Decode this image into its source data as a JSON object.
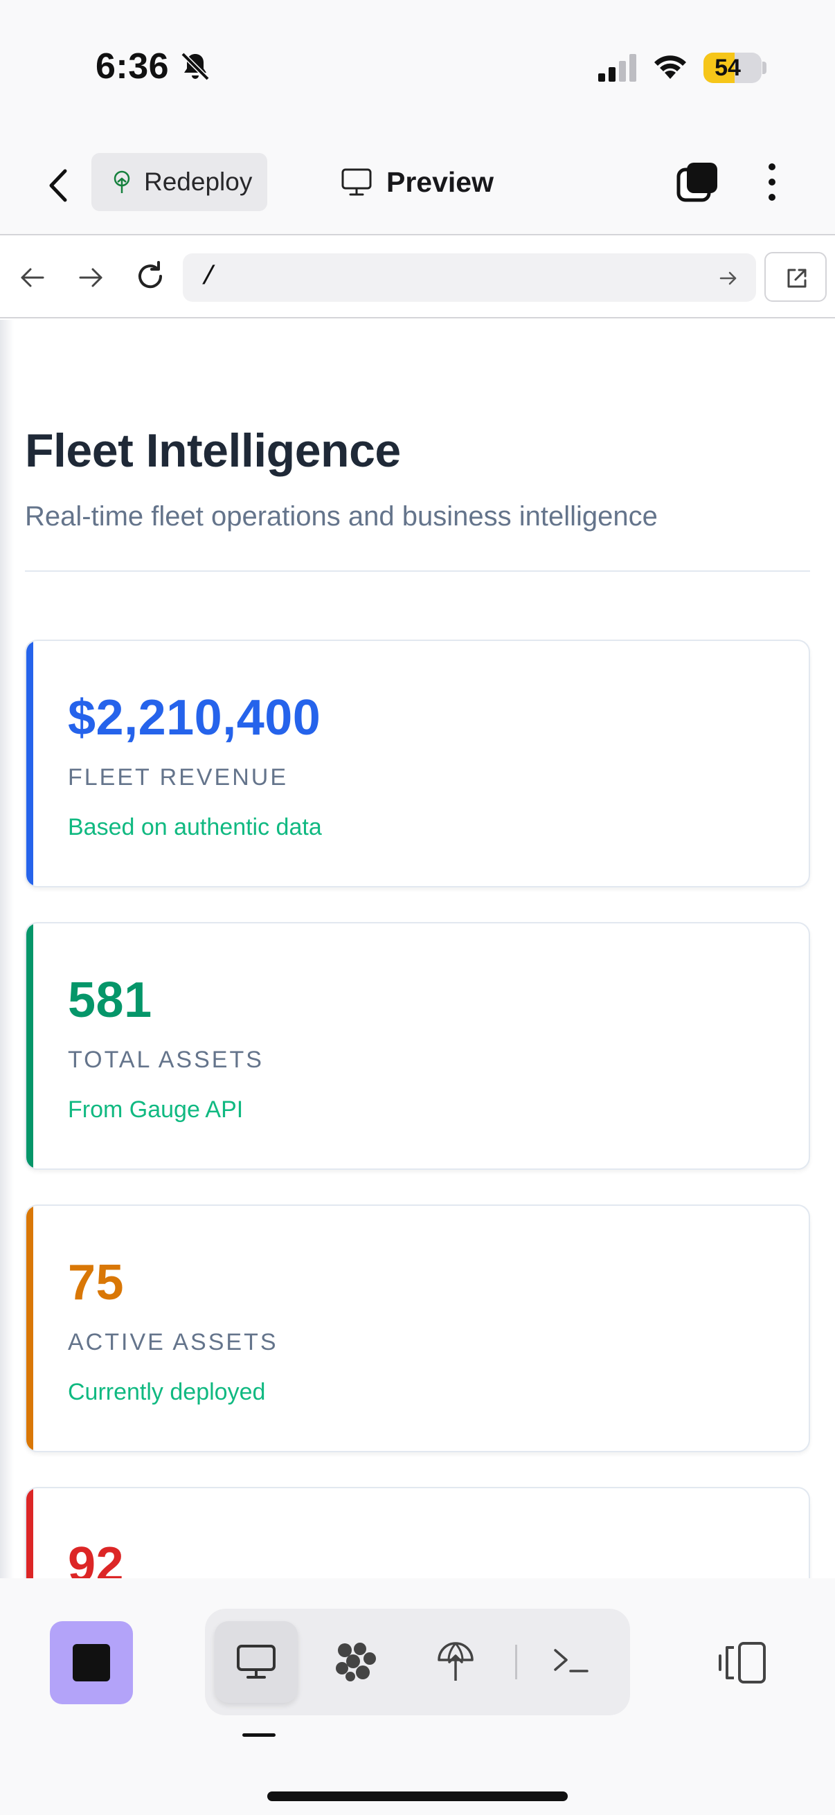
{
  "status_bar": {
    "time": "6:36",
    "battery_level": "54",
    "battery_fraction": 0.54,
    "battery_color": "#f6c619",
    "icons": [
      "bell-slash-icon",
      "cellular-signal-icon",
      "wifi-icon",
      "battery-icon"
    ]
  },
  "header": {
    "back_icon": "chevron-left-icon",
    "redeploy_label": "Redeploy",
    "redeploy_icon": "deploy-tree-icon",
    "preview_label": "Preview",
    "preview_icon": "monitor-icon",
    "tabs_icon": "tabs-stack-icon",
    "more_icon": "vertical-dots-icon"
  },
  "browser": {
    "url": "/",
    "icons": [
      "arrow-left-icon",
      "arrow-right-icon",
      "reload-icon",
      "arrow-go-icon",
      "open-external-icon"
    ]
  },
  "page": {
    "title": "Fleet Intelligence",
    "subtitle": "Real-time fleet operations and business intelligence",
    "metrics": [
      {
        "value": "$2,210,400",
        "label": "FLEET REVENUE",
        "note": "Based on authentic data",
        "accent": "#2563eb",
        "value_color": "#2563eb"
      },
      {
        "value": "581",
        "label": "TOTAL ASSETS",
        "note": "From Gauge API",
        "accent": "#059669",
        "value_color": "#059669"
      },
      {
        "value": "75",
        "label": "ACTIVE ASSETS",
        "note": "Currently deployed",
        "accent": "#d97706",
        "value_color": "#d97706"
      },
      {
        "value": "92",
        "accent": "#dc2626",
        "value_color": "#dc2626"
      }
    ]
  },
  "toolbar": {
    "stop_color": "#b3a3f9",
    "tools": [
      "monitor-icon",
      "agent-cluster-icon",
      "deploy-icon",
      "terminal-icon"
    ],
    "active_tool": "monitor-icon",
    "right_icon": "split-view-icon"
  }
}
